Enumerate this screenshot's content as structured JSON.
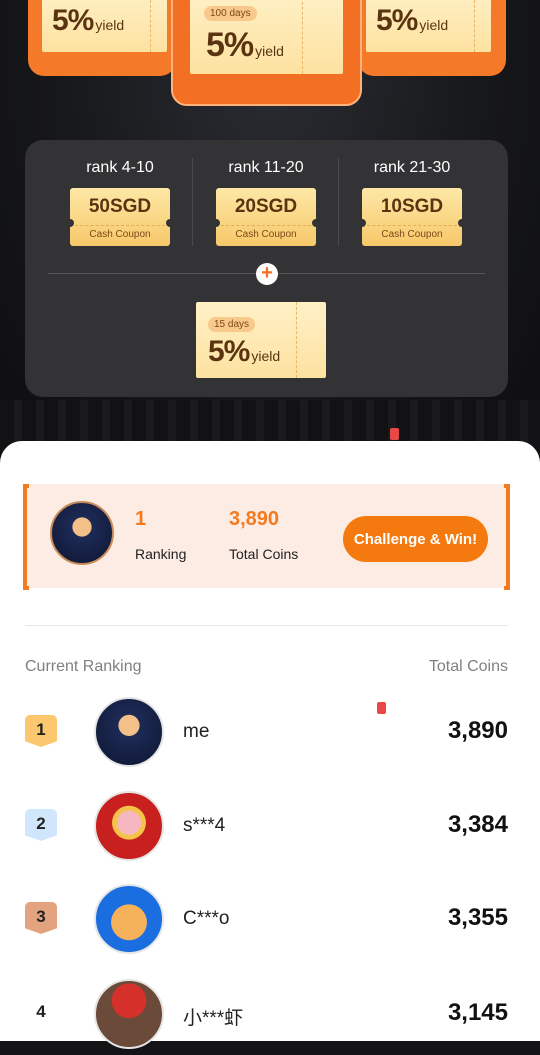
{
  "top_prizes": [
    {
      "days": "",
      "rate": "5%",
      "unit": "yield"
    },
    {
      "days": "100 days",
      "rate": "5%",
      "unit": "yield"
    },
    {
      "days": "",
      "rate": "5%",
      "unit": "yield"
    }
  ],
  "rewards": {
    "tiers": [
      {
        "rank": "rank 4-10",
        "amount": "50SGD",
        "type": "Cash Coupon"
      },
      {
        "rank": "rank 11-20",
        "amount": "20SGD",
        "type": "Cash Coupon"
      },
      {
        "rank": "rank 21-30",
        "amount": "10SGD",
        "type": "Cash Coupon"
      }
    ],
    "plus_symbol": "+",
    "bonus": {
      "days": "15 days",
      "rate": "5%",
      "unit": "yield"
    }
  },
  "my_status": {
    "ranking_value": "1",
    "ranking_label": "Ranking",
    "coins_value": "3,890",
    "coins_label": "Total Coins",
    "cta_label": "Challenge & Win!"
  },
  "leaderboard": {
    "header_left": "Current Ranking",
    "header_right": "Total Coins",
    "rows": [
      {
        "rank": "1",
        "name": "me",
        "coins": "3,890",
        "badge_color": "#fbc870",
        "avatar": "astronaut-fox-avatar"
      },
      {
        "rank": "2",
        "name": "s***4",
        "coins": "3,384",
        "badge_color": "#cfe6fb",
        "avatar": "pig-avatar"
      },
      {
        "rank": "3",
        "name": "C***o",
        "coins": "3,355",
        "badge_color": "#e3a37f",
        "avatar": "ox-avatar"
      },
      {
        "rank": "4",
        "name": "小***虾",
        "coins": "3,145",
        "badge_color": "#ffffff",
        "avatar": "mario-avatar"
      }
    ]
  },
  "colors": {
    "accent": "#f47a1f",
    "panel": "#333335",
    "card_bg": "#fdece3"
  }
}
